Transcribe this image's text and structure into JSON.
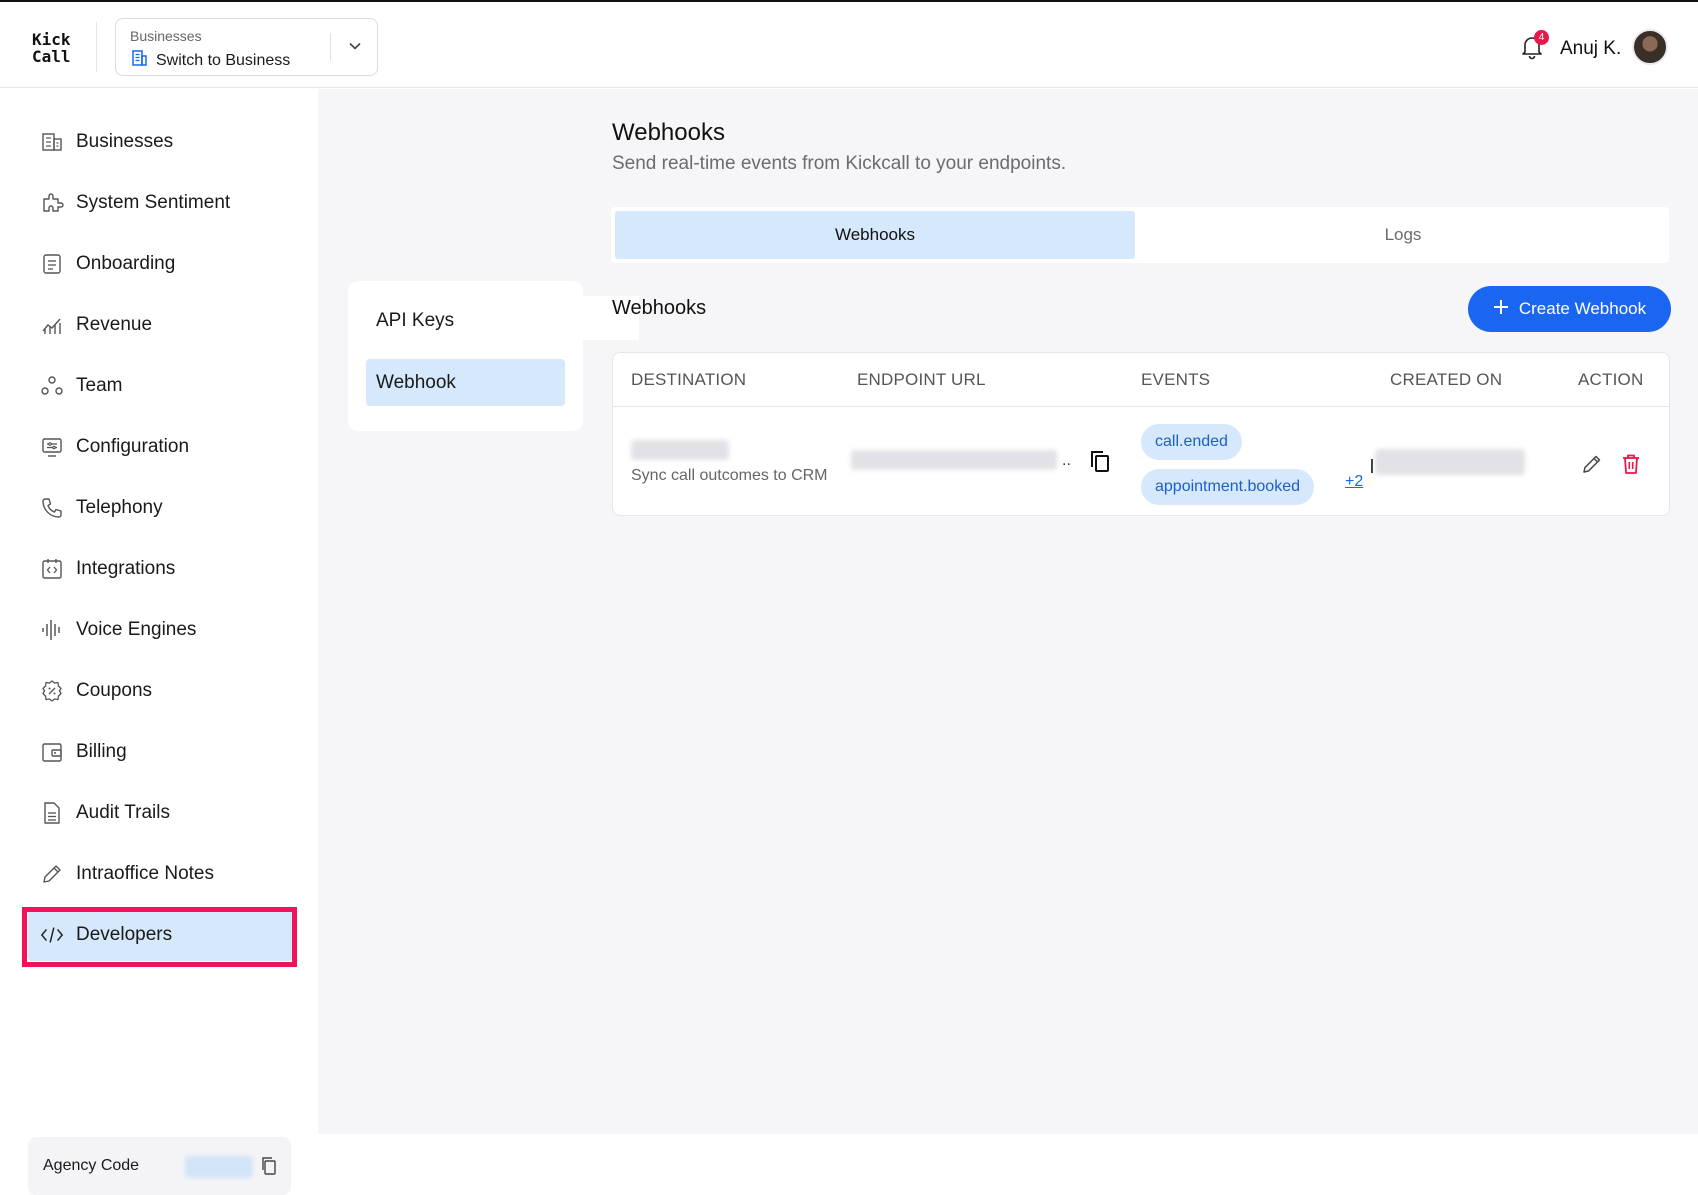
{
  "header": {
    "logo_line1": "Kick",
    "logo_line2": "Call",
    "business_switch": {
      "label": "Businesses",
      "value": "Switch to Business"
    },
    "notifications": {
      "count": "4"
    },
    "user": {
      "name": "Anuj K."
    }
  },
  "sidebar": {
    "items": [
      {
        "label": "Businesses",
        "icon": "building-icon"
      },
      {
        "label": "System Sentiment",
        "icon": "puzzle-icon"
      },
      {
        "label": "Onboarding",
        "icon": "document-icon"
      },
      {
        "label": "Revenue",
        "icon": "chart-icon"
      },
      {
        "label": "Team",
        "icon": "team-icon"
      },
      {
        "label": "Configuration",
        "icon": "config-icon"
      },
      {
        "label": "Telephony",
        "icon": "phone-icon"
      },
      {
        "label": "Integrations",
        "icon": "code-box-icon"
      },
      {
        "label": "Voice Engines",
        "icon": "waveform-icon"
      },
      {
        "label": "Coupons",
        "icon": "coupon-icon"
      },
      {
        "label": "Billing",
        "icon": "wallet-icon"
      },
      {
        "label": "Audit Trails",
        "icon": "file-icon"
      },
      {
        "label": "Intraoffice Notes",
        "icon": "pencil-icon"
      },
      {
        "label": "Developers",
        "icon": "code-icon"
      }
    ],
    "active": "Developers",
    "agency_code_label": "Agency Code"
  },
  "subnav": {
    "items": [
      "API Keys",
      "Webhook"
    ],
    "active": "Webhook"
  },
  "page": {
    "title": "Webhooks",
    "subtitle": "Send real-time events from Kickcall to your endpoints.",
    "tabs": [
      "Webhooks",
      "Logs"
    ],
    "active_tab": "Webhooks",
    "section_title": "Webhooks",
    "create_button": "Create Webhook"
  },
  "table": {
    "headers": [
      "DESTINATION",
      "ENDPOINT URL",
      "EVENTS",
      "CREATED ON",
      "ACTION"
    ],
    "rows": [
      {
        "destination_desc": "Sync call outcomes to CRM",
        "endpoint_suffix": "..",
        "events": [
          "call.ended",
          "appointment.booked"
        ],
        "more_events": "+2"
      }
    ]
  },
  "colors": {
    "accent": "#1a66f0",
    "active_bg": "#d5e8fc",
    "highlight": "#f0125a",
    "danger": "#e8184a"
  }
}
